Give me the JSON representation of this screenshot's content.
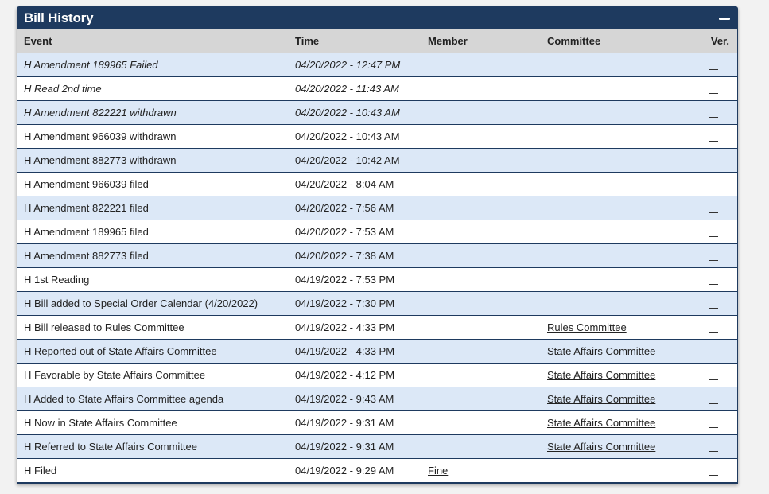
{
  "panel": {
    "title": "Bill History"
  },
  "columns": {
    "event": "Event",
    "time": "Time",
    "member": "Member",
    "committee": "Committee",
    "ver": "Ver."
  },
  "colors": {
    "header_bg": "#1e3a5f",
    "alt_row": "#dce8f7",
    "column_header_bg": "#d6d6d6"
  },
  "rows": [
    {
      "event": "H Amendment 189965 Failed",
      "time": "04/20/2022 - 12:47 PM",
      "member": "",
      "committee": "",
      "italic": true
    },
    {
      "event": "H Read 2nd time",
      "time": "04/20/2022 - 11:43 AM",
      "member": "",
      "committee": "",
      "italic": true
    },
    {
      "event": "H Amendment 822221 withdrawn",
      "time": "04/20/2022 - 10:43 AM",
      "member": "",
      "committee": "",
      "italic": true
    },
    {
      "event": "H Amendment 966039 withdrawn",
      "time": "04/20/2022 - 10:43 AM",
      "member": "",
      "committee": "",
      "italic": false
    },
    {
      "event": "H Amendment 882773 withdrawn",
      "time": "04/20/2022 - 10:42 AM",
      "member": "",
      "committee": "",
      "italic": false
    },
    {
      "event": "H Amendment 966039 filed",
      "time": "04/20/2022 - 8:04 AM",
      "member": "",
      "committee": "",
      "italic": false
    },
    {
      "event": "H Amendment 822221 filed",
      "time": "04/20/2022 - 7:56 AM",
      "member": "",
      "committee": "",
      "italic": false
    },
    {
      "event": "H Amendment 189965 filed",
      "time": "04/20/2022 - 7:53 AM",
      "member": "",
      "committee": "",
      "italic": false
    },
    {
      "event": "H Amendment 882773 filed",
      "time": "04/20/2022 - 7:38 AM",
      "member": "",
      "committee": "",
      "italic": false
    },
    {
      "event": "H 1st Reading",
      "time": "04/19/2022 - 7:53 PM",
      "member": "",
      "committee": "",
      "italic": false
    },
    {
      "event": "H Bill added to Special Order Calendar (4/20/2022)",
      "time": "04/19/2022 - 7:30 PM",
      "member": "",
      "committee": "",
      "italic": false
    },
    {
      "event": "H Bill released to Rules Committee",
      "time": "04/19/2022 - 4:33 PM",
      "member": "",
      "committee": "Rules Committee",
      "italic": false
    },
    {
      "event": "H Reported out of State Affairs Committee",
      "time": "04/19/2022 - 4:33 PM",
      "member": "",
      "committee": "State Affairs Committee",
      "italic": false
    },
    {
      "event": "H Favorable by State Affairs Committee",
      "time": "04/19/2022 - 4:12 PM",
      "member": "",
      "committee": "State Affairs Committee",
      "italic": false
    },
    {
      "event": "H Added to State Affairs Committee agenda",
      "time": "04/19/2022 - 9:43 AM",
      "member": "",
      "committee": "State Affairs Committee",
      "italic": false
    },
    {
      "event": "H Now in State Affairs Committee",
      "time": "04/19/2022 - 9:31 AM",
      "member": "",
      "committee": "State Affairs Committee",
      "italic": false
    },
    {
      "event": "H Referred to State Affairs Committee",
      "time": "04/19/2022 - 9:31 AM",
      "member": "",
      "committee": "State Affairs Committee",
      "italic": false
    },
    {
      "event": "H Filed",
      "time": "04/19/2022 - 9:29 AM",
      "member": "Fine",
      "committee": "",
      "italic": false
    }
  ]
}
